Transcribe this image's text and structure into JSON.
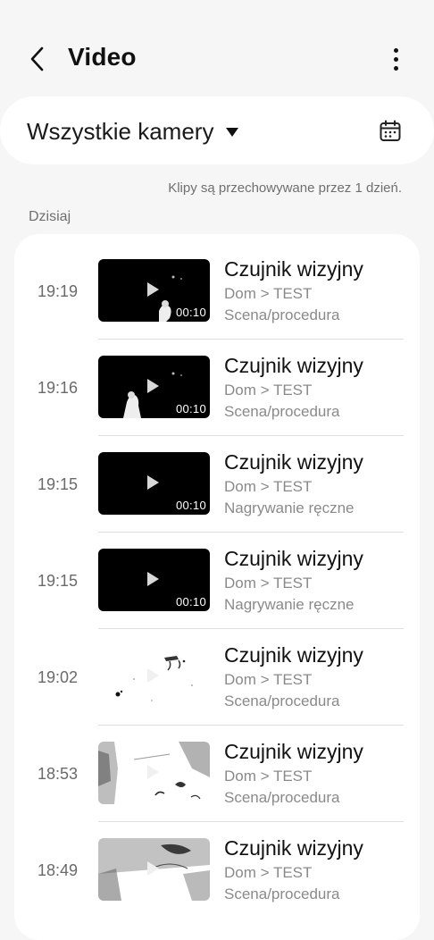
{
  "header": {
    "title": "Video"
  },
  "filter": {
    "camera_label": "Wszystkie kamery"
  },
  "retention_note": "Klipy są przechowywane przez 1 dzień.",
  "section_label": "Dzisiaj",
  "clips": [
    {
      "time": "19:19",
      "name": "Czujnik wizyjny",
      "path": "Dom > TEST",
      "trigger": "Scena/procedura",
      "duration": "00:10",
      "thumb_style": "dark"
    },
    {
      "time": "19:16",
      "name": "Czujnik wizyjny",
      "path": "Dom > TEST",
      "trigger": "Scena/procedura",
      "duration": "00:10",
      "thumb_style": "dark"
    },
    {
      "time": "19:15",
      "name": "Czujnik wizyjny",
      "path": "Dom > TEST",
      "trigger": "Nagrywanie ręczne",
      "duration": "00:10",
      "thumb_style": "dark"
    },
    {
      "time": "19:15",
      "name": "Czujnik wizyjny",
      "path": "Dom > TEST",
      "trigger": "Nagrywanie ręczne",
      "duration": "00:10",
      "thumb_style": "dark"
    },
    {
      "time": "19:02",
      "name": "Czujnik wizyjny",
      "path": "Dom > TEST",
      "trigger": "Scena/procedura",
      "duration": "",
      "thumb_style": "light"
    },
    {
      "time": "18:53",
      "name": "Czujnik wizyjny",
      "path": "Dom > TEST",
      "trigger": "Scena/procedura",
      "duration": "",
      "thumb_style": "light"
    },
    {
      "time": "18:49",
      "name": "Czujnik wizyjny",
      "path": "Dom > TEST",
      "trigger": "Scena/procedura",
      "duration": "",
      "thumb_style": "light"
    }
  ],
  "icons": {
    "back": "chevron-left-icon",
    "more": "more-vertical-icon",
    "dropdown": "caret-down-icon",
    "calendar": "calendar-icon",
    "play": "play-icon"
  }
}
